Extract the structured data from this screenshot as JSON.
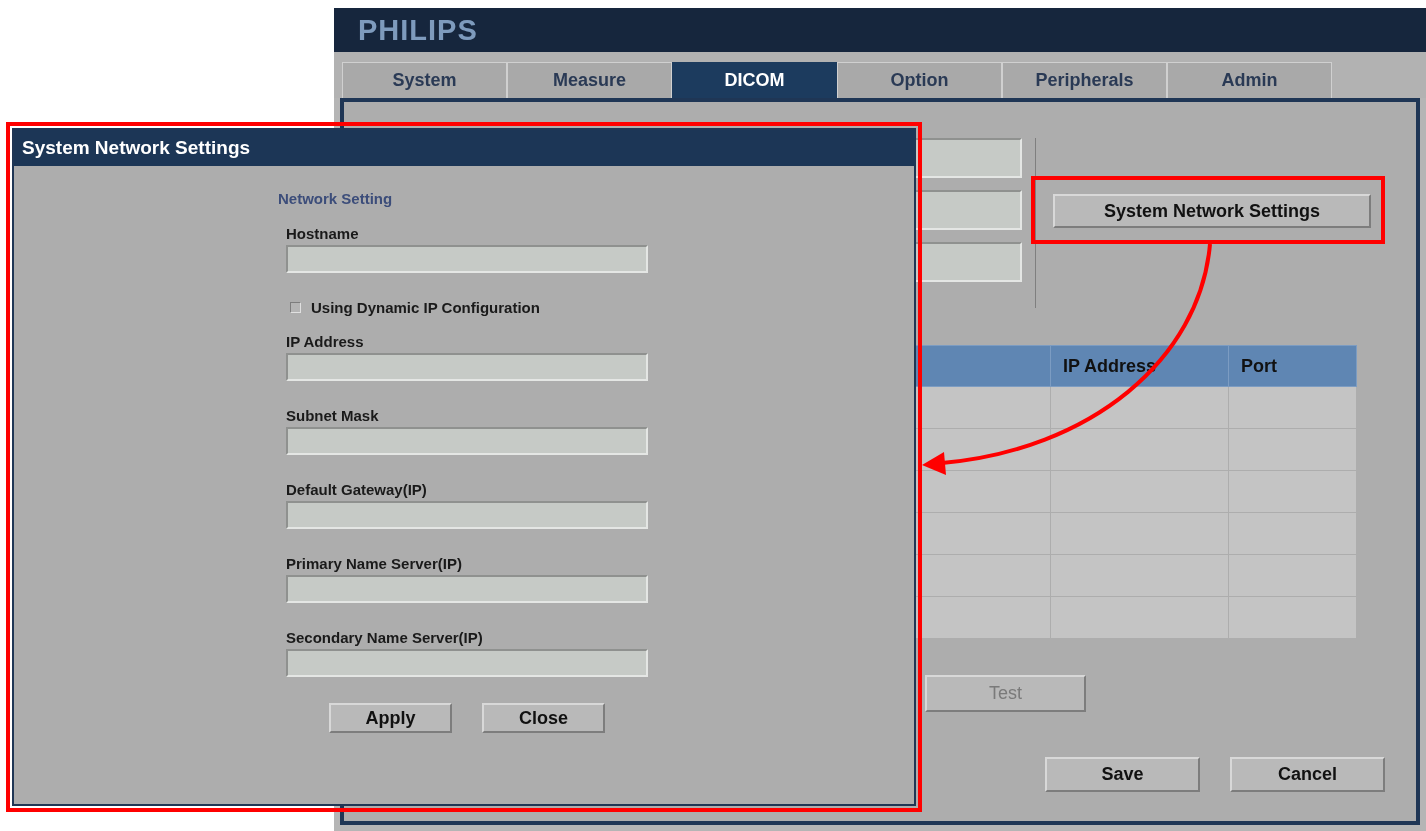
{
  "window": {
    "brand": "PHILIPS"
  },
  "tabs": [
    {
      "label": "System",
      "selected": false
    },
    {
      "label": "Measure",
      "selected": false
    },
    {
      "label": "DICOM",
      "selected": true
    },
    {
      "label": "Option",
      "selected": false
    },
    {
      "label": "Peripherals",
      "selected": false
    },
    {
      "label": "Admin",
      "selected": false
    }
  ],
  "network_button": "System Network Settings",
  "table": {
    "columns": [
      "IP Address",
      "Port"
    ]
  },
  "buttons": [
    {
      "label": "Test",
      "disabled": true
    },
    {
      "label": "Save",
      "disabled": false
    },
    {
      "label": "Cancel",
      "disabled": false
    }
  ],
  "dialog": {
    "title": "System Network Settings",
    "section": "Network Setting",
    "fields": [
      {
        "kind": "text",
        "label": "Hostname"
      },
      {
        "kind": "checkbox",
        "label": "Using Dynamic IP Configuration",
        "checked": false
      },
      {
        "kind": "text",
        "label": "IP Address"
      },
      {
        "kind": "text",
        "label": "Subnet Mask"
      },
      {
        "kind": "text",
        "label": "Default Gateway(IP)"
      },
      {
        "kind": "text",
        "label": "Primary Name Server(IP)"
      },
      {
        "kind": "text",
        "label": "Secondary Name Server(IP)"
      }
    ],
    "buttons": [
      "Apply",
      "Close"
    ]
  }
}
